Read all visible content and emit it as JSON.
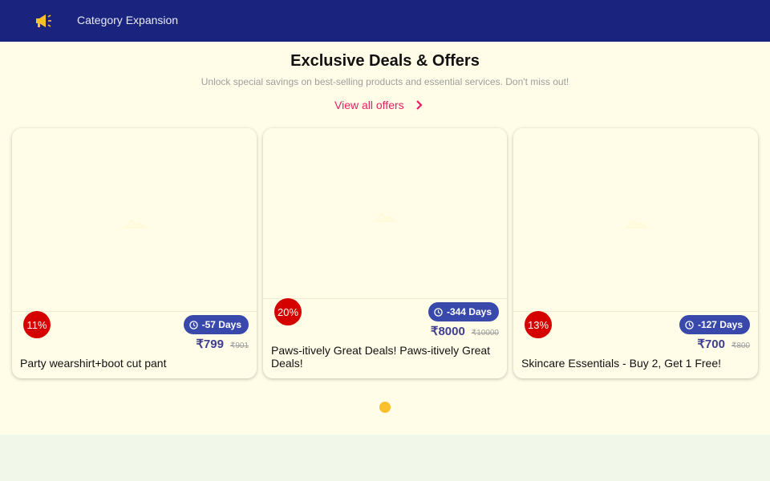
{
  "header": {
    "icon": "megaphone-icon",
    "title": "Category Expansion",
    "bg_color": "#1a237e"
  },
  "offers": {
    "title": "Exclusive Deals & Offers",
    "subtitle": "Unlock special savings on best-selling products and essential services. Don't miss out!",
    "view_all_label": "View all offers",
    "accent_color": "#e91e63",
    "cards": [
      {
        "discount": "11%",
        "days_left": "-57 Days",
        "price": "₹799",
        "original_price": "₹901",
        "name": "Party wearshirt+boot cut pant"
      },
      {
        "discount": "20%",
        "days_left": "-344 Days",
        "price": "₹8000",
        "original_price": "₹10000",
        "name": "Paws-itively Great Deals! Paws-itively Great Deals!"
      },
      {
        "discount": "13%",
        "days_left": "-127 Days",
        "price": "₹700",
        "original_price": "₹800",
        "name": "Skincare Essentials - Buy 2, Get 1 Free!"
      }
    ],
    "carousel": {
      "active_index": 0,
      "total": 1,
      "active_color": "#fbc02d"
    }
  }
}
